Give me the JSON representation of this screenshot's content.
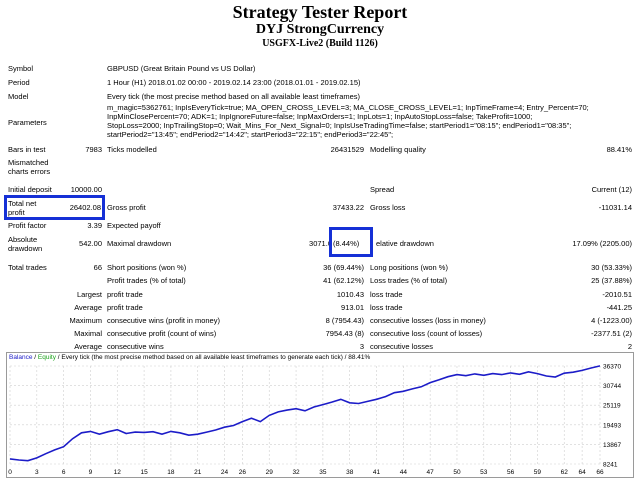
{
  "title": "Strategy Tester Report",
  "subtitle": "DYJ StrongCurrency",
  "server": "USGFX-Live2 (Build 1126)",
  "info": {
    "symbol_label": "Symbol",
    "symbol_value": "GBPUSD (Great Britain Pound vs US Dollar)",
    "period_label": "Period",
    "period_value": "1 Hour (H1) 2018.01.02 00:00 - 2019.02.14 23:00 (2018.01.01 - 2019.02.15)",
    "model_label": "Model",
    "model_value": "Every tick (the most precise method based on all available least timeframes)",
    "parameters_label": "Parameters",
    "parameters_lines": [
      "m_magic=5362761; InpIsEveryTick=true; MA_OPEN_CROSS_LEVEL=3; MA_CLOSE_CROSS_LEVEL=1; InpTimeFrame=4; Entry_Percent=70;",
      "InpMinClosePercent=70; ADK=1; InpIgnoreFuture=false; InpMaxOrders=1; InpLots=1; InpAutoStopLoss=false; TakeProfit=1000;",
      "StopLoss=2000; InpTrailingStop=0; Wait_Mins_For_Next_Signal=0; InpIsUseTradingTime=false; startPeriod1=\"08:15\"; endPeriod1=\"08:35\";",
      "startPeriod2=\"13:45\"; endPeriod2=\"14:42\"; startPeriod3=\"22:15\"; endPeriod3=\"22:45\";"
    ]
  },
  "stats": {
    "bars_label": "Bars in test",
    "bars_value": "7983",
    "ticks_label": "Ticks modelled",
    "ticks_value": "26431529",
    "quality_label": "Modelling quality",
    "quality_value": "88.41%",
    "mismatched_label_1": "Mismatched",
    "mismatched_label_2": "charts errors",
    "deposit_label": "Initial deposit",
    "deposit_value": "10000.00",
    "spread_label": "Spread",
    "spread_value": "Current (12)",
    "netprofit_label_1": "Total net",
    "netprofit_label_2": "profit",
    "netprofit_value": "26402.08",
    "grossprofit_label": "Gross profit",
    "grossprofit_value": "37433.22",
    "grossloss_label": "Gross loss",
    "grossloss_value": "-11031.14",
    "pf_label": "Profit factor",
    "pf_value": "3.39",
    "payoff_label": "Expected payoff",
    "absdd_label_1": "Absolute",
    "absdd_label_2": "drawdown",
    "absdd_value": "542.00",
    "maxdd_label": "Maximal drawdown",
    "maxdd_value": "3071.0",
    "maxdd_pct": "(8.44%)",
    "reldd_label": "elative drawdown",
    "reldd_value": "17.09% (2205.00)",
    "trades_label": "Total trades",
    "trades_value": "66",
    "short_label": "Short positions (won %)",
    "short_value": "36 (69.44%)",
    "long_label": "Long positions (won %)",
    "long_value": "30 (53.33%)",
    "ptrades_label": "Profit trades (% of total)",
    "ptrades_value": "41 (62.12%)",
    "ltrades_label": "Loss trades (% of total)",
    "ltrades_value": "25 (37.88%)",
    "largest_label": "Largest",
    "largest_profit_label": "profit trade",
    "largest_profit_value": "1010.43",
    "largest_loss_label": "loss trade",
    "largest_loss_value": "-2010.51",
    "average_label": "Average",
    "average_profit_label": "profit trade",
    "average_profit_value": "913.01",
    "average_loss_label": "loss trade",
    "average_loss_value": "-441.25",
    "maximum_label": "Maximum",
    "maxwins_label": "consecutive wins (profit in money)",
    "maxwins_value": "8 (7954.43)",
    "maxlosses_label": "consecutive losses (loss in money)",
    "maxlosses_value": "4 (-1223.00)",
    "maximal_label": "Maximal",
    "maxprofit_label": "consecutive profit (count of wins)",
    "maxprofit_value": "7954.43 (8)",
    "maxloss_label": "consecutive loss (count of losses)",
    "maxloss_value": "-2377.51 (2)",
    "avg2_label": "Average",
    "avgwins_label": "consecutive wins",
    "avgwins_value": "3",
    "avglosses_label": "consecutive losses",
    "avglosses_value": "2"
  },
  "chart_data": {
    "type": "line",
    "title_balance": "Balance",
    "title_sep": " / ",
    "title_equity": "Equity",
    "title_rest": " / Every tick (the most precise method based on all available least timeframes to generate each tick) / 88.41%",
    "x_ticks": [
      "0",
      "3",
      "6",
      "9",
      "12",
      "15",
      "18",
      "21",
      "24",
      "26",
      "29",
      "32",
      "35",
      "38",
      "41",
      "44",
      "47",
      "50",
      "53",
      "56",
      "59",
      "62",
      "64",
      "66"
    ],
    "y_ticks": [
      "36370",
      "30744",
      "25119",
      "19493",
      "13867",
      "8241"
    ],
    "ylim": [
      8241,
      36370
    ],
    "series": [
      {
        "x": [
          0,
          1,
          2,
          3,
          4,
          5,
          6,
          7,
          8,
          9,
          10,
          11,
          12,
          13,
          14,
          15,
          16,
          17,
          18,
          19,
          20,
          21,
          22,
          23,
          24,
          25,
          26,
          27,
          28,
          29,
          30,
          31,
          32,
          33,
          34,
          35,
          36,
          37,
          38,
          39,
          40,
          41,
          42,
          43,
          44,
          45,
          46,
          47,
          48,
          49,
          50,
          51,
          52,
          53,
          54,
          55,
          56,
          57,
          58,
          59,
          60,
          61,
          62,
          63,
          64,
          65,
          66
        ],
        "y": [
          9700,
          9400,
          9200,
          10000,
          11200,
          12300,
          13200,
          15500,
          17200,
          17600,
          16800,
          17500,
          18100,
          17000,
          17400,
          17300,
          17500,
          16800,
          17600,
          17200,
          16500,
          16800,
          17400,
          18000,
          18800,
          19300,
          20400,
          21400,
          20400,
          22200,
          23200,
          23700,
          24100,
          23500,
          24600,
          25300,
          26000,
          26800,
          25800,
          25600,
          26200,
          26800,
          27600,
          28700,
          29100,
          29800,
          30400,
          31600,
          32400,
          33300,
          33900,
          33600,
          34100,
          33700,
          34200,
          33900,
          34400,
          34000,
          34700,
          34200,
          33500,
          33200,
          34300,
          34600,
          35100,
          35800,
          36400
        ]
      }
    ],
    "colors": {
      "balance": "#1c1cc8",
      "equity": "#1aa11a",
      "grid": "#cfcfcf"
    }
  }
}
